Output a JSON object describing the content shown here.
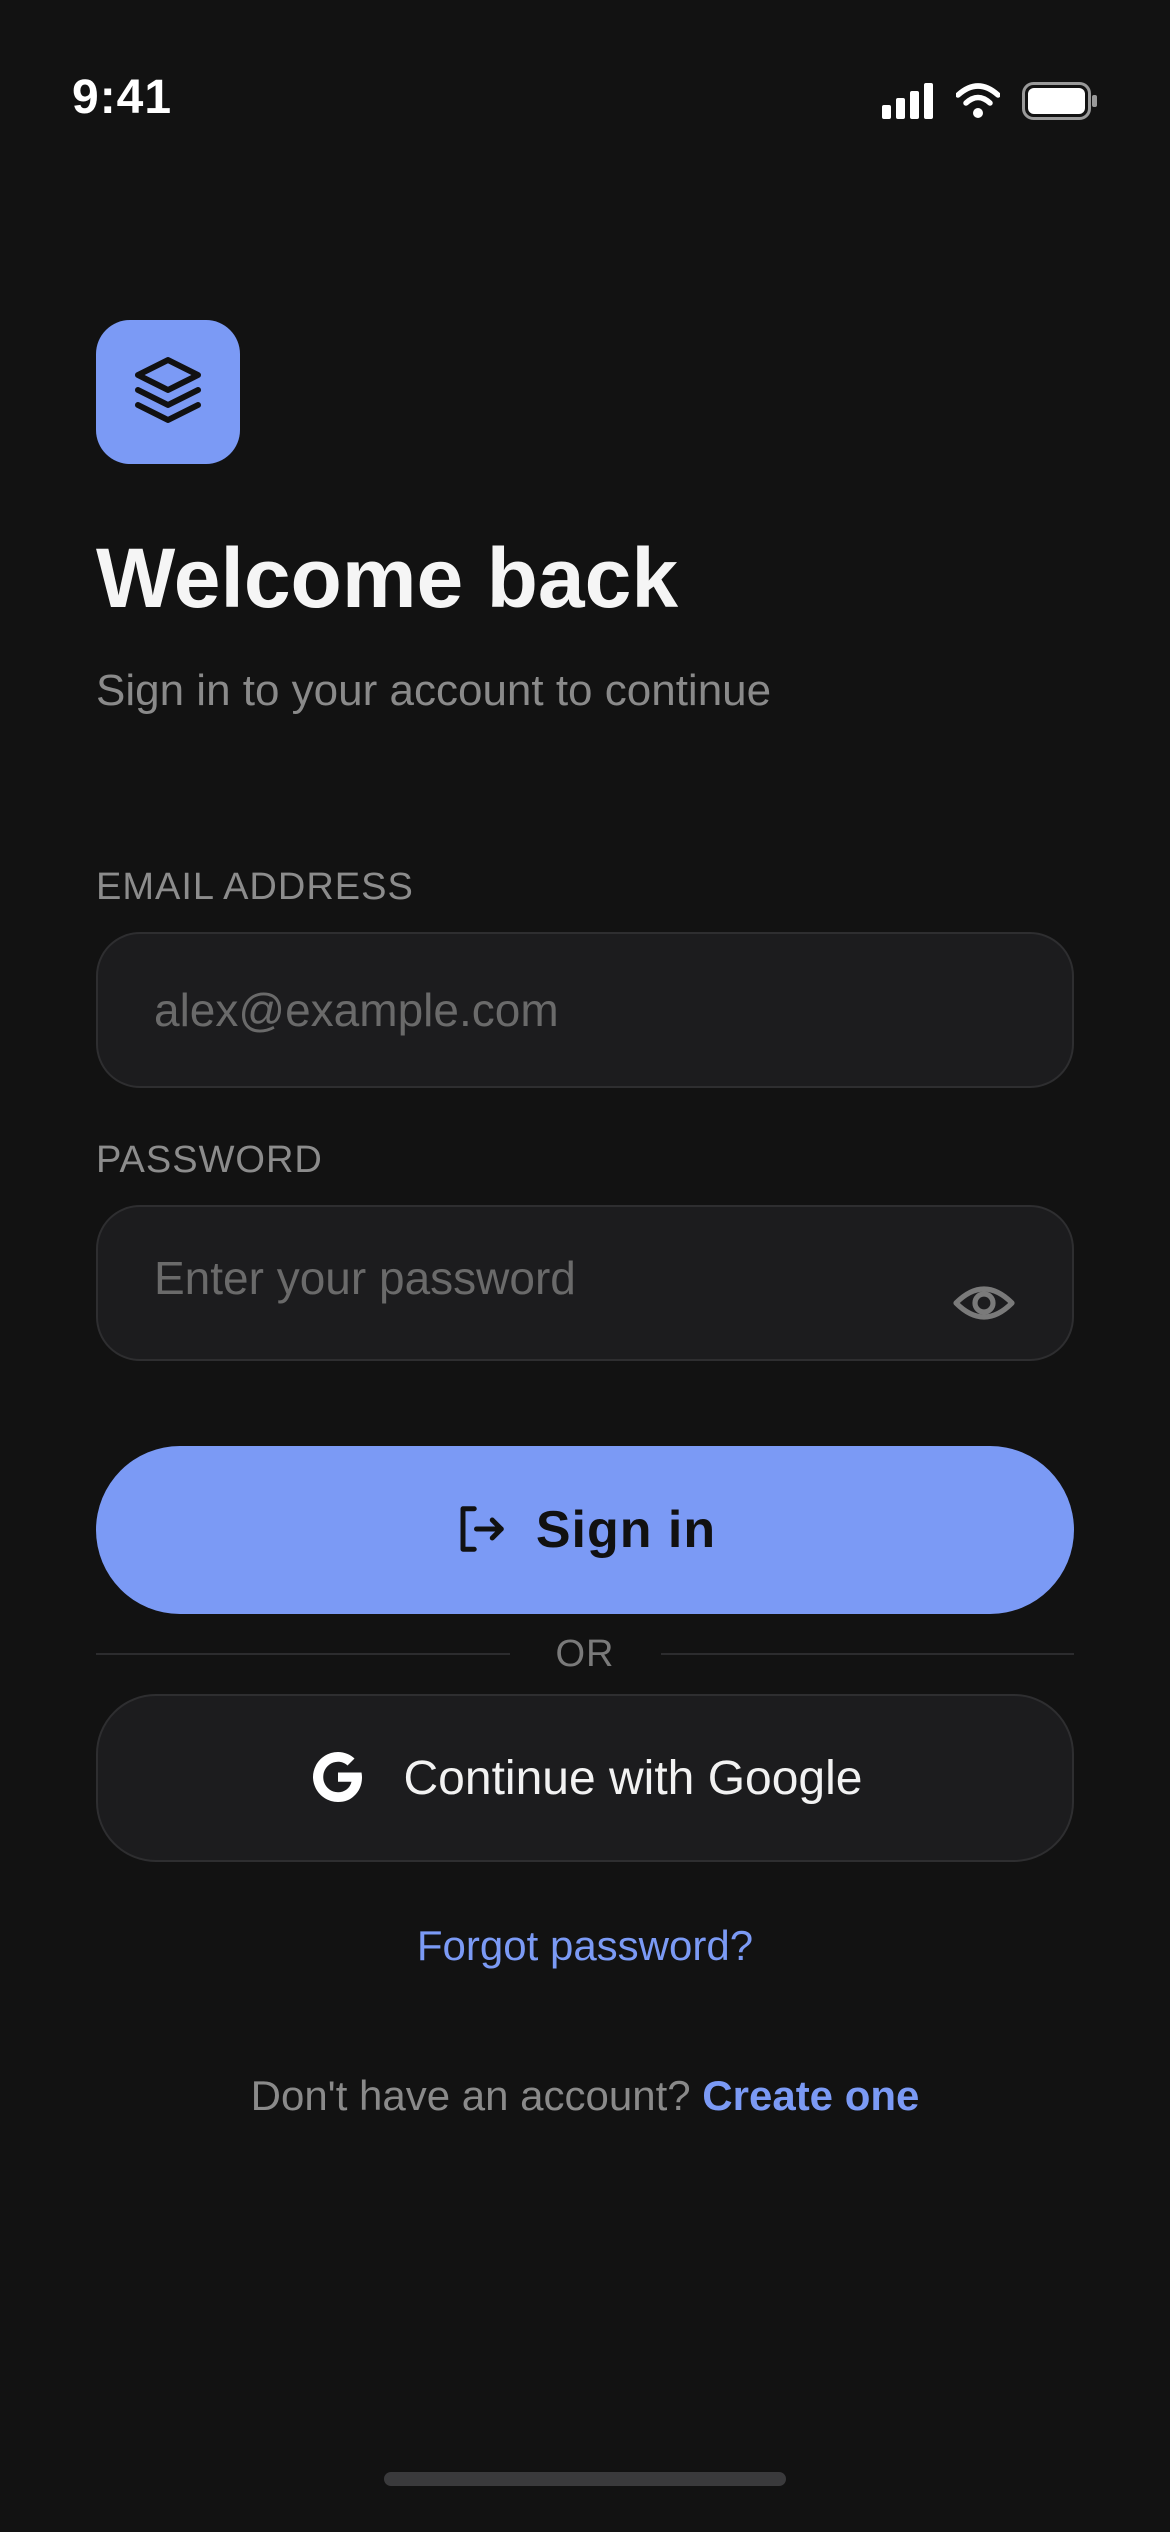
{
  "status_bar": {
    "time": "9:41",
    "icons": [
      "cellular-signal-icon",
      "wifi-icon",
      "battery-icon"
    ]
  },
  "brand": {
    "logo_icon": "layers-icon",
    "accent_color": "#7b9af5"
  },
  "header": {
    "title": "Welcome back",
    "subtitle": "Sign in to your account to continue"
  },
  "form": {
    "email_label": "EMAIL ADDRESS",
    "email_placeholder": "alex@example.com",
    "email_value": "",
    "password_label": "PASSWORD",
    "password_placeholder": "Enter your password",
    "password_value": "",
    "password_toggle_icon": "eye-icon"
  },
  "actions": {
    "sign_in_label": "Sign in",
    "sign_in_icon": "log-in-icon",
    "divider_text": "OR",
    "google_label": "Continue with Google",
    "google_icon": "google-icon",
    "forgot_password_label": "Forgot password?"
  },
  "footer": {
    "no_account_text": "Don't have an account?",
    "create_account_label": "Create one"
  }
}
